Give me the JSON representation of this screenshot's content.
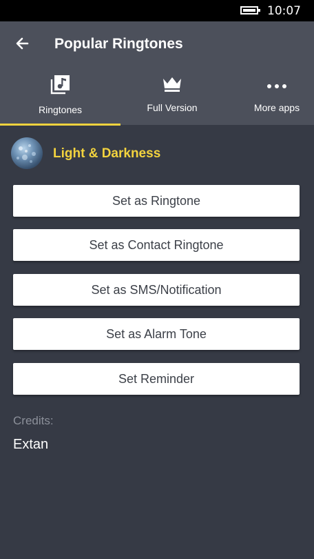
{
  "status_bar": {
    "time": "10:07",
    "icons": [
      "battery-icon"
    ]
  },
  "header": {
    "title": "Popular Ringtones",
    "back_icon": "back-arrow-icon"
  },
  "tabs": [
    {
      "label": "Ringtones",
      "icon": "music-library-icon",
      "selected": true
    },
    {
      "label": "Full Version",
      "icon": "crown-icon",
      "selected": false
    },
    {
      "label": "More apps",
      "icon": "more-dots-icon",
      "selected": false
    }
  ],
  "song": {
    "title": "Light & Darkness",
    "thumbnail_icon": "song-thumbnail"
  },
  "actions": [
    {
      "label": "Set as Ringtone"
    },
    {
      "label": "Set as Contact Ringtone"
    },
    {
      "label": "Set as SMS/Notification"
    },
    {
      "label": "Set as Alarm Tone"
    },
    {
      "label": "Set Reminder"
    }
  ],
  "credits": {
    "label": "Credits:",
    "value": "Extan"
  },
  "colors": {
    "accent": "#f3d33e",
    "background": "#363a45",
    "app_bar": "#4c505b",
    "button": "#ffffff"
  }
}
